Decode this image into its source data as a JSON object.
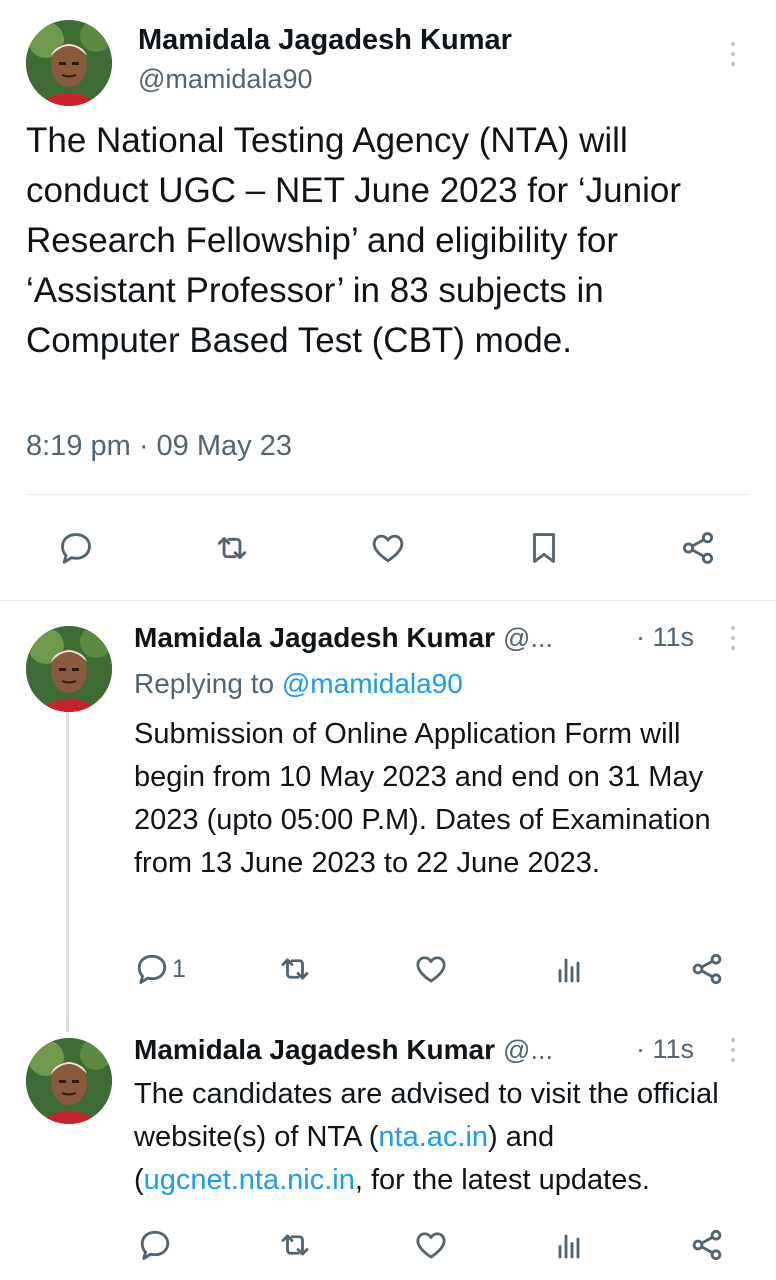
{
  "main_tweet": {
    "author_name": "Mamidala Jagadesh Kumar",
    "author_handle": "@mamidala90",
    "text": "The National Testing Agency (NTA) will conduct UGC – NET June 2023 for ‘Junior Research Fellowship’ and eligibility for ‘Assistant Professor’ in 83 subjects in Computer Based Test (CBT) mode.",
    "timestamp": "8:19 pm · 09 May 23",
    "actions": [
      "reply-icon",
      "retweet-icon",
      "like-icon",
      "bookmark-icon",
      "share-icon"
    ]
  },
  "replies": [
    {
      "author_name": "Mamidala Jagadesh Kumar",
      "author_handle": "@...",
      "time": "· 11s",
      "replying_prefix": "Replying to",
      "replying_mention": "@mamidala90",
      "text": "Submission of Online Application Form will begin from 10 May 2023 and end on 31 May 2023 (upto 05:00 P.M). Dates of Examination from 13 June 2023 to 22 June 2023.",
      "reply_count": "1"
    },
    {
      "author_name": "Mamidala Jagadesh Kumar",
      "author_handle": "@...",
      "time": "· 11s",
      "text_before": "The candidates are advised to visit the official website(s) of NTA (",
      "link1": "nta.ac.in",
      "text_middle": ") and (",
      "link2": "ugcnet.nta.nic.in",
      "text_after": ", for the latest updates."
    }
  ],
  "colors": {
    "text": "#0f1419",
    "secondary": "#536471",
    "link": "#1d9bf0",
    "divider": "#e8ecef"
  }
}
